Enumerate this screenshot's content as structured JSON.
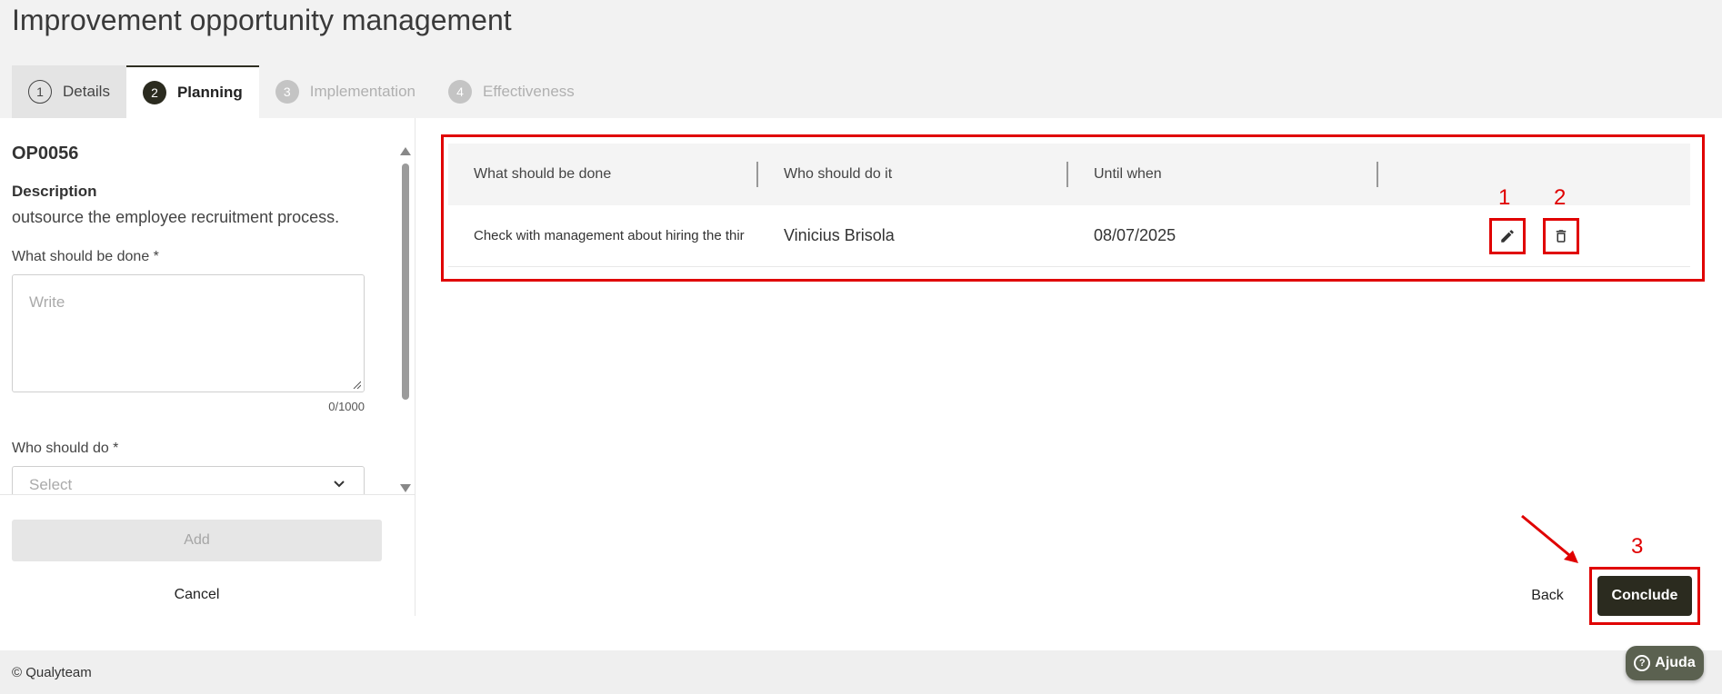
{
  "page": {
    "title": "Improvement opportunity management"
  },
  "tabs": [
    {
      "num": "1",
      "label": "Details",
      "state": "done"
    },
    {
      "num": "2",
      "label": "Planning",
      "state": "active"
    },
    {
      "num": "3",
      "label": "Implementation",
      "state": "disabled"
    },
    {
      "num": "4",
      "label": "Effectiveness",
      "state": "disabled"
    }
  ],
  "form": {
    "code": "OP0056",
    "description_label": "Description",
    "description_text": "outsource the employee recruitment process.",
    "what_label": "What should be done *",
    "what_placeholder": "Write",
    "counter": "0/1000",
    "who_label": "Who should do *",
    "who_placeholder": "Select",
    "add_label": "Add",
    "cancel_label": "Cancel"
  },
  "table": {
    "headers": [
      "What should be done",
      "Who should do it",
      "Until when"
    ],
    "rows": [
      {
        "what": "Check with management about hiring the thir",
        "who": "Vinicius Brisola",
        "until": "08/07/2025"
      }
    ]
  },
  "annotations": {
    "edit": "1",
    "delete": "2",
    "conclude": "3"
  },
  "actions": {
    "back_label": "Back",
    "conclude_label": "Conclude"
  },
  "footer": {
    "copyright": "© Qualyteam",
    "help_label": "Ajuda"
  },
  "colors": {
    "accent": "#2b2b1f",
    "highlight": "#e00000",
    "help": "#5b6150"
  }
}
